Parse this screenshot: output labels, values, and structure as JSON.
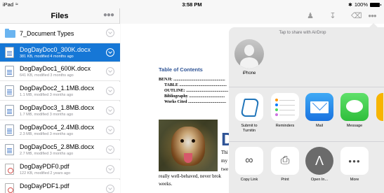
{
  "status_bar": {
    "device": "iPad",
    "time": "3:58 PM",
    "battery": "100%"
  },
  "files_pane": {
    "title": "Files",
    "items": [
      {
        "name": "7_Document Types",
        "meta": "",
        "type": "folder",
        "selected": false
      },
      {
        "name": "DogDayDoc0_300K.docx",
        "meta": "381 KB, modified 4 months ago",
        "type": "doc",
        "selected": true
      },
      {
        "name": "DogDayDoc1_600K.docx",
        "meta": "641 KB, modified 3 months ago",
        "type": "doc",
        "selected": false
      },
      {
        "name": "DogDayDoc2_1.1MB.docx",
        "meta": "1.1 MB, modified 3 months ago",
        "type": "doc",
        "selected": false
      },
      {
        "name": "DogDayDoc3_1.8MB.docx",
        "meta": "1.7 MB, modified 3 months ago",
        "type": "doc",
        "selected": false
      },
      {
        "name": "DogDayDoc4_2.4MB.docx",
        "meta": "2.3 MB, modified 3 months ago",
        "type": "doc",
        "selected": false
      },
      {
        "name": "DogDayDoc5_2.8MB.docx",
        "meta": "2.7 MB, modified 3 months ago",
        "type": "doc",
        "selected": false
      },
      {
        "name": "DogDayPDF0.pdf",
        "meta": "122 KB, modified 2 years ago",
        "type": "pdf",
        "selected": false
      },
      {
        "name": "DogDayPDF1.pdf",
        "meta": "",
        "type": "pdf",
        "selected": false
      }
    ]
  },
  "document": {
    "toc_heading": "Table of Contents",
    "toc_lines": [
      "BENJI: .................................................",
      "TABLE .............................................",
      "OUTLINE: ........................................",
      "Bibliography ..................................",
      "Works Cited ...................................."
    ],
    "big_letter": "D",
    "body_lines": [
      "Thi",
      "my",
      "twe",
      "really well-behaved, never brok",
      "weeks."
    ]
  },
  "share_sheet": {
    "airdrop_hint": "Tap to share with AirDrop",
    "airdrop_person": "iPhone",
    "apps": [
      {
        "label": "Submit to\nTurnitin",
        "icon": "turnitin-icon"
      },
      {
        "label": "Reminders",
        "icon": "reminders-icon"
      },
      {
        "label": "Mail",
        "icon": "mail-icon"
      },
      {
        "label": "Message",
        "icon": "message-icon"
      }
    ],
    "actions": [
      {
        "label": "Copy Link",
        "icon": "link-icon"
      },
      {
        "label": "Print",
        "icon": "printer-icon"
      },
      {
        "label": "Open In...",
        "icon": "open-in-icon"
      },
      {
        "label": "More",
        "icon": "more-icon"
      }
    ]
  },
  "colors": {
    "selection": "#1677d6",
    "accent": "#2f5496",
    "sheet": "#ebebeb"
  }
}
